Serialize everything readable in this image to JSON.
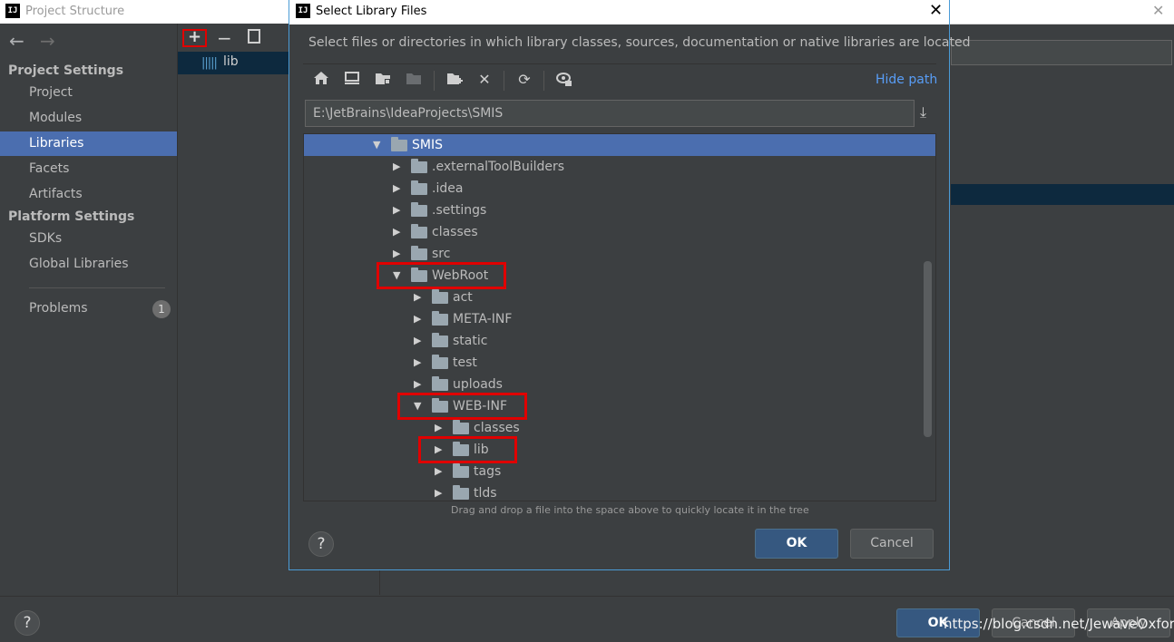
{
  "background_window": {
    "title": "Project Structure",
    "app_icon": "IJ",
    "close_glyph": "✕",
    "nav": {
      "sections": [
        {
          "header": "Project Settings",
          "items": [
            "Project",
            "Modules",
            "Libraries",
            "Facets",
            "Artifacts"
          ]
        },
        {
          "header": "Platform Settings",
          "items": [
            "SDKs",
            "Global Libraries"
          ]
        }
      ],
      "selected": "Libraries",
      "problems_label": "Problems",
      "problems_count": "1"
    },
    "libraries": {
      "toolbar": [
        "add-icon",
        "remove-icon",
        "copy-icon"
      ],
      "items": [
        "lib"
      ]
    },
    "footer": {
      "help": "?",
      "ok_label": "OK",
      "cancel_label": "Cancel",
      "apply_label": "Apply"
    },
    "watermark": "https://blog.csdn.net/JewaveOxford"
  },
  "dialog": {
    "title": "Select Library Files",
    "app_icon": "IJ",
    "close_glyph": "✕",
    "description": "Select files or directories in which library classes, sources, documentation or native libraries are located",
    "toolbar_icons": [
      "home-icon",
      "desktop-icon",
      "project-folder-icon",
      "module-folder-icon",
      "new-folder-icon",
      "delete-icon",
      "refresh-icon",
      "show-hidden-icon"
    ],
    "hide_path_label": "Hide path",
    "path": "E:\\JetBrains\\IdeaProjects\\SMIS",
    "tree": [
      {
        "label": "SMIS",
        "depth": 0,
        "expanded": true,
        "selected": true
      },
      {
        "label": ".externalToolBuilders",
        "depth": 1,
        "expanded": false
      },
      {
        "label": ".idea",
        "depth": 1,
        "expanded": false
      },
      {
        "label": ".settings",
        "depth": 1,
        "expanded": false
      },
      {
        "label": "classes",
        "depth": 1,
        "expanded": false
      },
      {
        "label": "src",
        "depth": 1,
        "expanded": false
      },
      {
        "label": "WebRoot",
        "depth": 1,
        "expanded": true,
        "highlighted": true
      },
      {
        "label": "act",
        "depth": 2,
        "expanded": false
      },
      {
        "label": "META-INF",
        "depth": 2,
        "expanded": false
      },
      {
        "label": "static",
        "depth": 2,
        "expanded": false
      },
      {
        "label": "test",
        "depth": 2,
        "expanded": false
      },
      {
        "label": "uploads",
        "depth": 2,
        "expanded": false
      },
      {
        "label": "WEB-INF",
        "depth": 2,
        "expanded": true,
        "highlighted": true
      },
      {
        "label": "classes",
        "depth": 3,
        "expanded": false
      },
      {
        "label": "lib",
        "depth": 3,
        "expanded": false,
        "highlighted": true
      },
      {
        "label": "tags",
        "depth": 3,
        "expanded": false
      },
      {
        "label": "tlds",
        "depth": 3,
        "expanded": false
      }
    ],
    "drag_drop_hint": "Drag and drop a file into the space above to quickly locate it in the tree",
    "help": "?",
    "ok_label": "OK",
    "cancel_label": "Cancel"
  },
  "colors": {
    "selection": "#4b6eaf",
    "highlight_box": "#e00000",
    "link": "#589df6",
    "dialog_border": "#4a9bd6"
  }
}
